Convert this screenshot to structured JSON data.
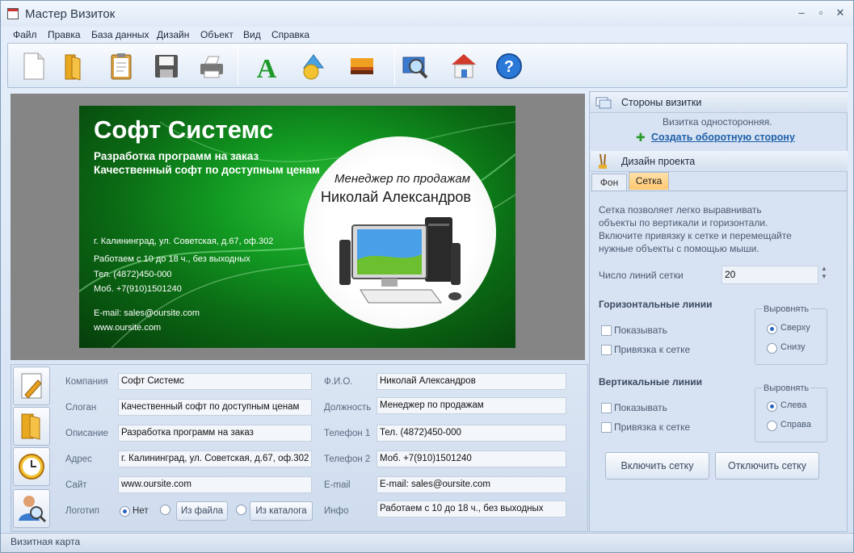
{
  "window": {
    "title": "Мастер Визиток",
    "minimize": "–",
    "restore": "▫",
    "close": "✕"
  },
  "menu": [
    "Файл",
    "Правка",
    "База данных",
    "Дизайн",
    "Объект",
    "Вид",
    "Справка"
  ],
  "card": {
    "company": "Софт Системс",
    "desc1": "Разработка программ на заказ",
    "desc2": "Качественный софт по доступным ценам",
    "address": "г. Калининград, ул. Советская, д.67, оф.302",
    "hours": "Работаем с 10 до 18 ч., без выходных",
    "phone1": "Тел. (4872)450-000",
    "phone2": "Моб. +7(910)1501240",
    "email": "E-mail: sales@oursite.com",
    "site": "www.oursite.com",
    "position": "Менеджер по продажам",
    "name": "Николай Александров"
  },
  "form": {
    "labels": {
      "company": "Компания",
      "slogan": "Слоган",
      "desc": "Описание",
      "address": "Адрес",
      "site": "Сайт",
      "logo": "Логотип",
      "fio": "Ф.И.О.",
      "position": "Должность",
      "phone1": "Телефон 1",
      "phone2": "Телефон 2",
      "email": "E-mail",
      "info": "Инфо"
    },
    "values": {
      "company": "Софт Системс",
      "slogan": "Качественный софт по доступным ценам",
      "desc": "Разработка программ на заказ",
      "address": "г. Калининград, ул. Советская, д.67, оф.302",
      "site": "www.oursite.com",
      "fio": "Николай Александров",
      "position": "Менеджер по продажам",
      "phone1": "Тел. (4872)450-000",
      "phone2": "Моб. +7(910)1501240",
      "email": "E-mail: sales@oursite.com",
      "info": "Работаем с 10 до 18 ч., без выходных"
    },
    "logo_none": "Нет",
    "logo_file": "Из файла",
    "logo_catalog": "Из каталога"
  },
  "right": {
    "sides_title": "Стороны визитки",
    "sides_info": "Визитка односторонняя.",
    "create_back": "Создать оборотную сторону",
    "design_title": "Дизайн проекта",
    "tab_bg": "Фон",
    "tab_grid": "Сетка",
    "grid_desc": [
      "Сетка позволяет легко выравнивать",
      "объекты по вертикали и горизонтали.",
      "Включите привязку к сетке и перемещайте",
      "нужные объекты с помощью мыши."
    ],
    "grid_lines_label": "Число линий сетки",
    "grid_lines_value": "20",
    "horizontal_title": "Горизонтальные линии",
    "vertical_title": "Вертикальные линии",
    "show": "Показывать",
    "snap": "Привязка к сетке",
    "align_title": "Выровнять",
    "top": "Сверху",
    "bottom": "Снизу",
    "left": "Слева",
    "right": "Справа",
    "enable_grid": "Включить сетку",
    "disable_grid": "Отключить сетку"
  },
  "status": "Визитная карта"
}
